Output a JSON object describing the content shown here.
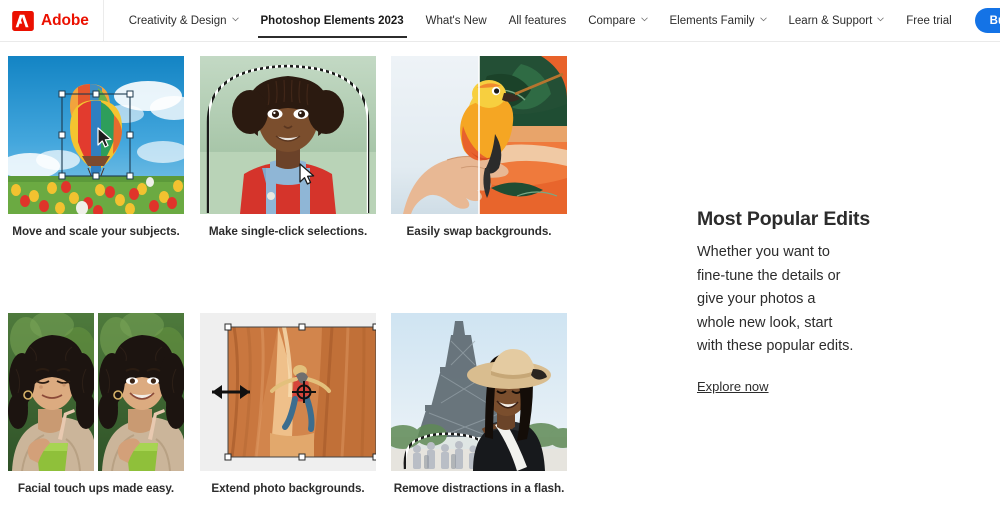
{
  "nav": {
    "brand": {
      "word": "Adobe",
      "icon": "adobe-logo-icon"
    },
    "items": [
      {
        "label": "Creativity & Design",
        "caret": true,
        "active": false
      },
      {
        "label": "Photoshop Elements 2023",
        "caret": false,
        "active": true
      },
      {
        "label": "What's New",
        "caret": false,
        "active": false
      },
      {
        "label": "All features",
        "caret": false,
        "active": false
      },
      {
        "label": "Compare",
        "caret": true,
        "active": false
      },
      {
        "label": "Elements Family",
        "caret": true,
        "active": false
      },
      {
        "label": "Learn & Support",
        "caret": true,
        "active": false
      },
      {
        "label": "Free trial",
        "caret": false,
        "active": false
      }
    ],
    "buy_label": "Buy now",
    "buy_color": "#1473e6",
    "brand_color": "#eb1000",
    "right_icons": [
      "search-icon",
      "user-avatar",
      "app-grid-icon"
    ],
    "avatar_color": "#12c2e9"
  },
  "tiles": [
    {
      "caption": "Move and scale your subjects.",
      "art": "hot-air-balloon-with-transform-handles"
    },
    {
      "caption": "Make single-click selections.",
      "art": "child-portrait-with-marching-ants-selection"
    },
    {
      "caption": "Easily swap backgrounds.",
      "art": "parrot-on-hand-background-swap-split"
    },
    {
      "caption": "Facial touch ups made easy.",
      "art": "before-after-woman-smiling-smoothie"
    },
    {
      "caption": "Extend photo backgrounds.",
      "art": "slot-canyon-hiker-extend-canvas"
    },
    {
      "caption": "Remove distractions in a flash.",
      "art": "eiffel-tower-woman-remove-crowd"
    }
  ],
  "panel": {
    "title": "Most Popular Edits",
    "body": "Whether you want to fine-tune the details or give your photos a whole new look, start with these popular edits.",
    "link": "Explore now"
  }
}
